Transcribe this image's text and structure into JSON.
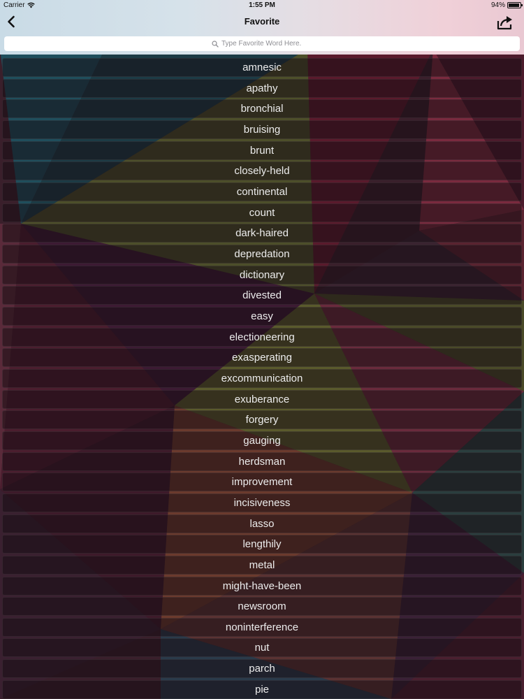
{
  "status": {
    "carrier": "Carrier",
    "time": "1:55 PM",
    "battery": "94%",
    "battery_level": 0.94
  },
  "nav": {
    "title": "Favorite",
    "back_icon": "chevron-left-icon",
    "share_icon": "share-icon"
  },
  "search": {
    "placeholder": "Type Favorite Word Here.",
    "value": ""
  },
  "colors": {
    "nav_bar_bg": "#d6e2ea",
    "search_bg": "#ffffff",
    "row_text": "#ececec"
  },
  "words": [
    "amnesic",
    "apathy",
    "bronchial",
    "bruising",
    "brunt",
    "closely-held",
    "continental",
    "count",
    "dark-haired",
    "depredation",
    "dictionary",
    "divested",
    "easy",
    "electioneering",
    "exasperating",
    "excommunication",
    "exuberance",
    "forgery",
    "gauging",
    "herdsman",
    "improvement",
    "incisiveness",
    "lasso",
    "lengthily",
    "metal",
    "might-have-been",
    "newsroom",
    "noninterference",
    "nut",
    "parch",
    "pie"
  ]
}
